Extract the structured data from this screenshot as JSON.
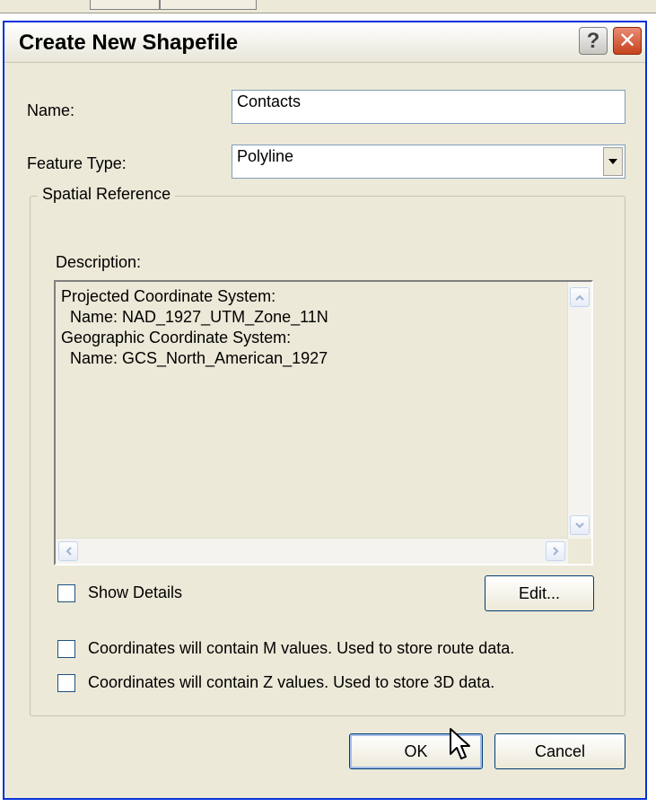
{
  "dialog": {
    "title": "Create New Shapefile",
    "help_symbol": "?",
    "close_symbol": "✕"
  },
  "form": {
    "name_label": "Name:",
    "name_value": "Contacts",
    "feature_type_label": "Feature Type:",
    "feature_type_value": "Polyline"
  },
  "spatial_reference": {
    "legend": "Spatial Reference",
    "description_label": "Description:",
    "description_lines": [
      "Projected Coordinate System:",
      "  Name: NAD_1927_UTM_Zone_11N",
      "",
      "Geographic Coordinate System:",
      "  Name: GCS_North_American_1927"
    ],
    "show_details_label": "Show Details",
    "show_details_checked": false,
    "edit_button": "Edit...",
    "m_values_label": "Coordinates will contain M values. Used to store route data.",
    "m_values_checked": false,
    "z_values_label": "Coordinates will contain Z values. Used to store 3D data.",
    "z_values_checked": false
  },
  "buttons": {
    "ok": "OK",
    "cancel": "Cancel"
  },
  "colors": {
    "dialog_face": "#ece9d8",
    "close_red": "#c6421c",
    "frame_blue": "#0831d9"
  }
}
